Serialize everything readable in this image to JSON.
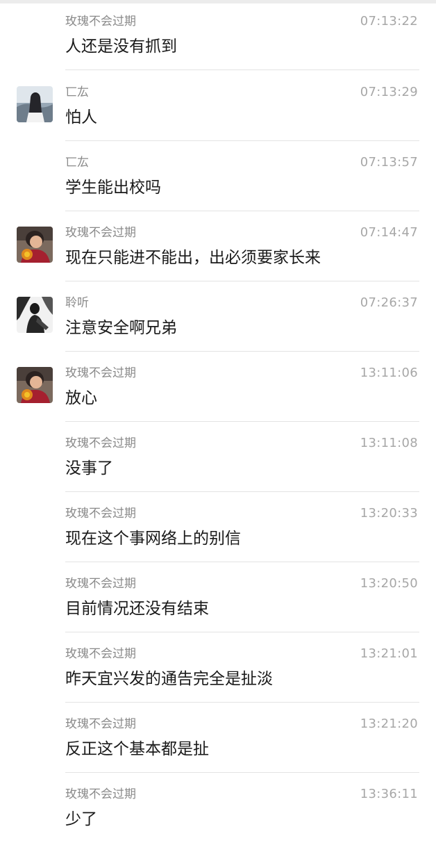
{
  "messages": [
    {
      "sender": "玫瑰不会过期",
      "time": "07:13:22",
      "text": "人还是没有抓到",
      "avatar": "none"
    },
    {
      "sender": "匸厷",
      "time": "07:13:29",
      "text": "怕人",
      "avatar": "landscape-girl"
    },
    {
      "sender": "匸厷",
      "time": "07:13:57",
      "text": "学生能出校吗",
      "avatar": "none"
    },
    {
      "sender": "玫瑰不会过期",
      "time": "07:14:47",
      "text": "现在只能进不能出，出必须要家长来",
      "avatar": "boy-red"
    },
    {
      "sender": "聆听",
      "time": "07:26:37",
      "text": "注意安全啊兄弟",
      "avatar": "ink-figure"
    },
    {
      "sender": "玫瑰不会过期",
      "time": "13:11:06",
      "text": "放心",
      "avatar": "boy-red"
    },
    {
      "sender": "玫瑰不会过期",
      "time": "13:11:08",
      "text": "没事了",
      "avatar": "none"
    },
    {
      "sender": "玫瑰不会过期",
      "time": "13:20:33",
      "text": "现在这个事网络上的别信",
      "avatar": "none"
    },
    {
      "sender": "玫瑰不会过期",
      "time": "13:20:50",
      "text": "目前情况还没有结束",
      "avatar": "none"
    },
    {
      "sender": "玫瑰不会过期",
      "time": "13:21:01",
      "text": "昨天宜兴发的通告完全是扯淡",
      "avatar": "none"
    },
    {
      "sender": "玫瑰不会过期",
      "time": "13:21:20",
      "text": "反正这个基本都是扯",
      "avatar": "none"
    },
    {
      "sender": "玫瑰不会过期",
      "time": "13:36:11",
      "text": "少了",
      "avatar": "none"
    }
  ]
}
